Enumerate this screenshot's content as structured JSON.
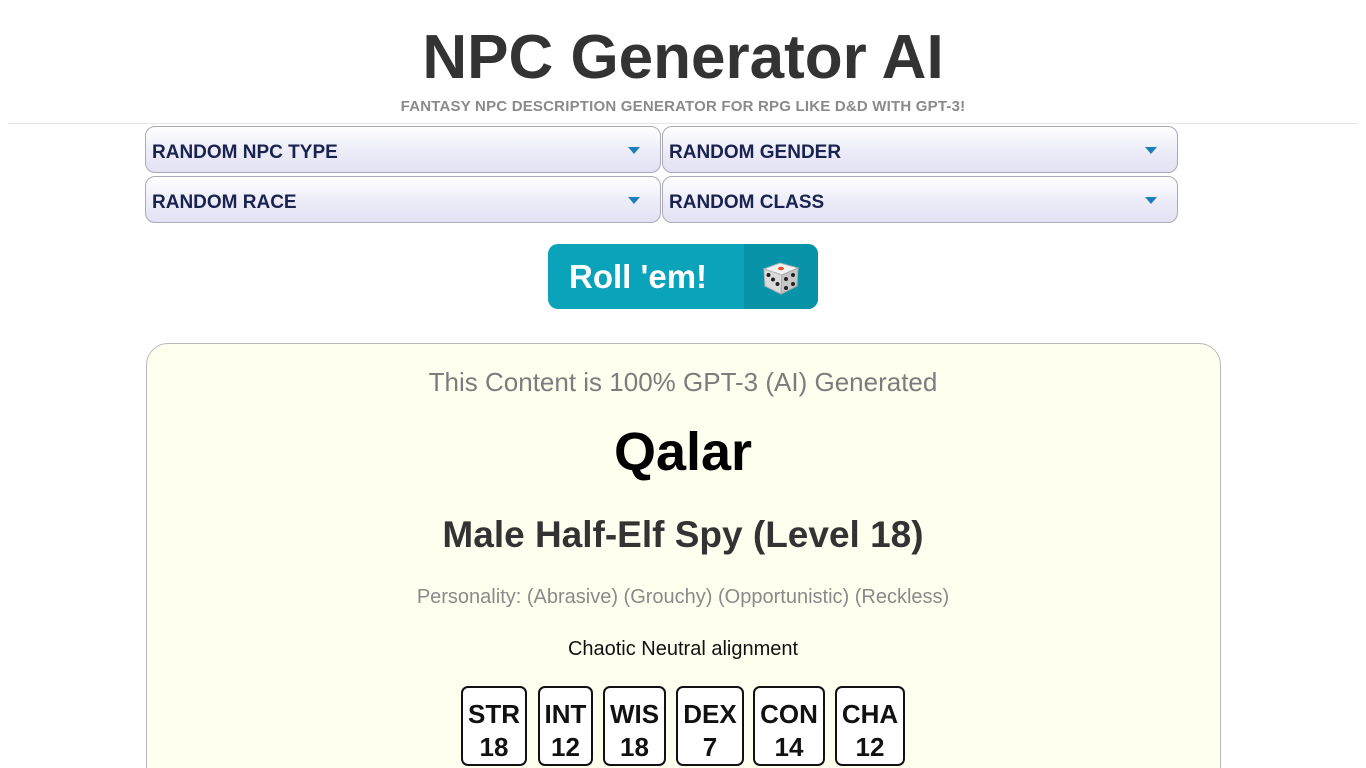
{
  "header": {
    "title": "NPC Generator AI",
    "subtitle": "FANTASY NPC DESCRIPTION GENERATOR FOR RPG LIKE D&D WITH GPT-3!"
  },
  "filters": [
    {
      "label": "RANDOM NPC TYPE"
    },
    {
      "label": "RANDOM GENDER"
    },
    {
      "label": "RANDOM RACE"
    },
    {
      "label": "RANDOM CLASS"
    }
  ],
  "roll_button": {
    "label": "Roll 'em!",
    "icon": "dice-icon"
  },
  "result": {
    "ai_note": "This Content is 100% GPT-3 (AI) Generated",
    "name": "Qalar",
    "summary": "Male Half-Elf Spy (Level 18)",
    "personality": "Personality: (Abrasive) (Grouchy) (Opportunistic) (Reckless)",
    "alignment": "Chaotic Neutral alignment",
    "stats": [
      {
        "name": "STR",
        "value": "18"
      },
      {
        "name": "INT",
        "value": "12"
      },
      {
        "name": "WIS",
        "value": "18"
      },
      {
        "name": "DEX",
        "value": "7"
      },
      {
        "name": "CON",
        "value": "14"
      },
      {
        "name": "CHA",
        "value": "12"
      }
    ]
  },
  "colors": {
    "button": "#0aa3ba",
    "card_background": "#fffff0",
    "select_text": "#1a2350",
    "chevron": "#1e7fb8"
  }
}
